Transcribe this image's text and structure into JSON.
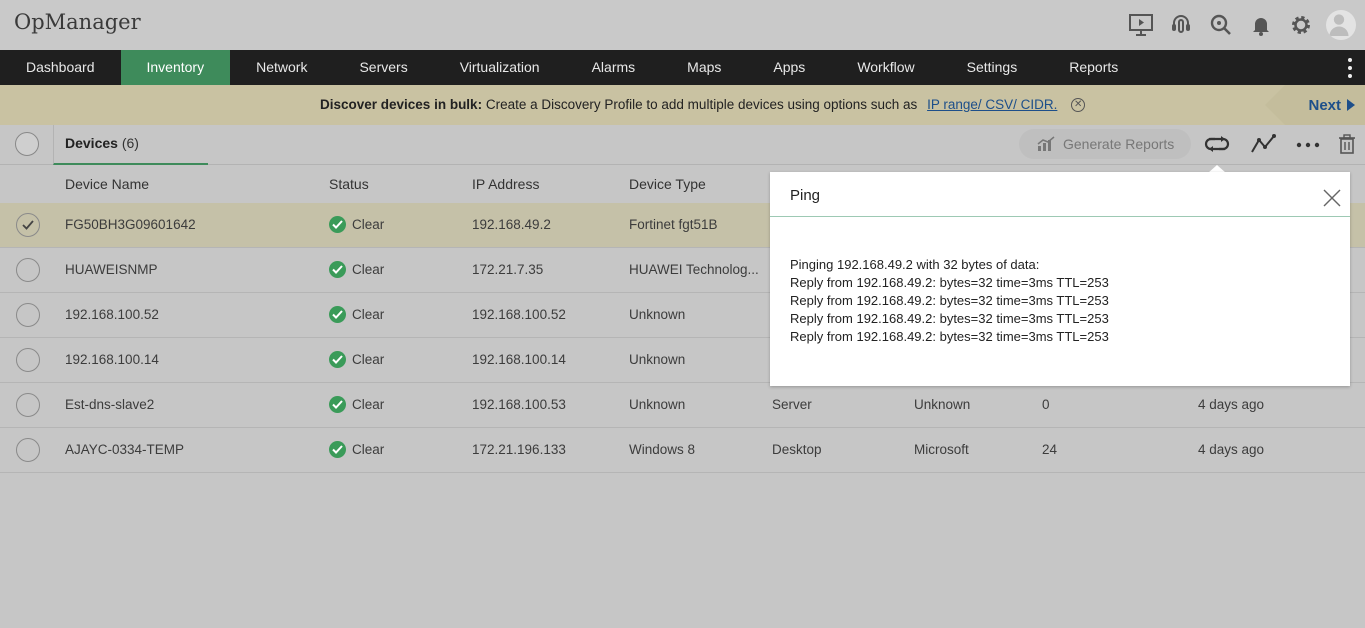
{
  "app": {
    "title": "OpManager"
  },
  "nav": {
    "items": [
      {
        "label": "Dashboard",
        "active": false
      },
      {
        "label": "Inventory",
        "active": true
      },
      {
        "label": "Network",
        "active": false
      },
      {
        "label": "Servers",
        "active": false
      },
      {
        "label": "Virtualization",
        "active": false
      },
      {
        "label": "Alarms",
        "active": false
      },
      {
        "label": "Maps",
        "active": false
      },
      {
        "label": "Apps",
        "active": false
      },
      {
        "label": "Workflow",
        "active": false
      },
      {
        "label": "Settings",
        "active": false
      },
      {
        "label": "Reports",
        "active": false
      }
    ]
  },
  "banner": {
    "bold": "Discover devices in bulk:",
    "text": "Create a Discovery Profile to add multiple devices using options such as",
    "link": "IP range/ CSV/ CIDR.",
    "next": "Next"
  },
  "toolbar": {
    "tab_label": "Devices",
    "tab_count": "(6)",
    "generate_reports": "Generate Reports"
  },
  "table": {
    "headers": {
      "name": "Device Name",
      "status": "Status",
      "ip": "IP Address",
      "type": "Device Type"
    },
    "rows": [
      {
        "name": "FG50BH3G09601642",
        "status": "Clear",
        "ip": "192.168.49.2",
        "type": "Fortinet fgt51B",
        "category": "",
        "vendor": "",
        "interfaces": "",
        "added": "",
        "selected": true
      },
      {
        "name": "HUAWEISNMP",
        "status": "Clear",
        "ip": "172.21.7.35",
        "type": "HUAWEI Technolog...",
        "category": "",
        "vendor": "",
        "interfaces": "",
        "added": "",
        "selected": false
      },
      {
        "name": "192.168.100.52",
        "status": "Clear",
        "ip": "192.168.100.52",
        "type": "Unknown",
        "category": "",
        "vendor": "",
        "interfaces": "",
        "added": "",
        "selected": false
      },
      {
        "name": "192.168.100.14",
        "status": "Clear",
        "ip": "192.168.100.14",
        "type": "Unknown",
        "category": "",
        "vendor": "",
        "interfaces": "",
        "added": "",
        "selected": false
      },
      {
        "name": "Est-dns-slave2",
        "status": "Clear",
        "ip": "192.168.100.53",
        "type": "Unknown",
        "category": "Server",
        "vendor": "Unknown",
        "interfaces": "0",
        "added": "4 days ago",
        "selected": false
      },
      {
        "name": "AJAYC-0334-TEMP",
        "status": "Clear",
        "ip": "172.21.196.133",
        "type": "Windows 8",
        "category": "Desktop",
        "vendor": "Microsoft",
        "interfaces": "24",
        "added": "4 days ago",
        "selected": false
      }
    ]
  },
  "ping": {
    "title": "Ping",
    "lines": [
      "Pinging 192.168.49.2 with 32 bytes of data:",
      "Reply from 192.168.49.2: bytes=32 time=3ms TTL=253",
      "Reply from 192.168.49.2: bytes=32 time=3ms TTL=253",
      "Reply from 192.168.49.2: bytes=32 time=3ms TTL=253",
      "Reply from 192.168.49.2: bytes=32 time=3ms TTL=253"
    ]
  },
  "icons": {
    "top": [
      "presentation-icon",
      "support-headset-icon",
      "search-icon",
      "bell-icon",
      "gear-icon"
    ],
    "toolbar": [
      "generate-reports-icon",
      "sync-icon",
      "graph-icon",
      "more-icon",
      "trash-icon"
    ]
  },
  "colors": {
    "accent": "#3e8b5b",
    "status_clear": "#3a9b59",
    "link": "#1d4f8a",
    "navbar": "#1f1f1f"
  }
}
